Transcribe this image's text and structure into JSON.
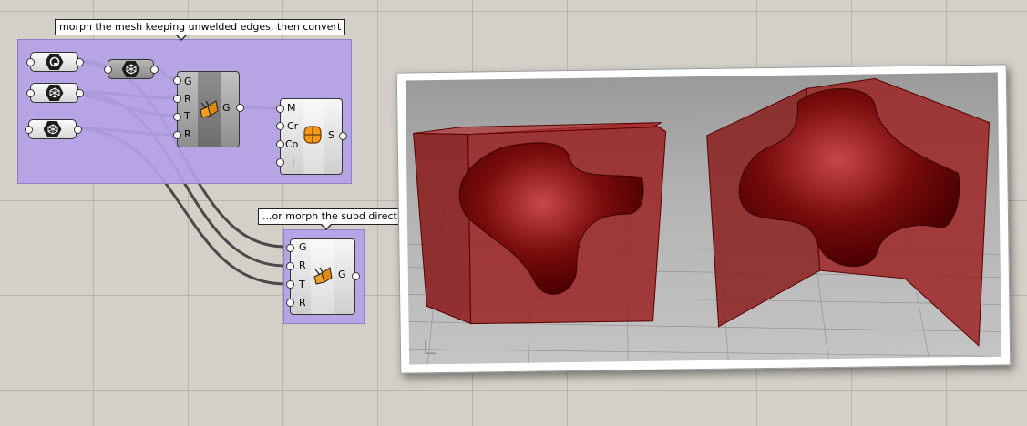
{
  "groups": {
    "mesh_group_label": "morph the mesh keeping unwelded edges, then convert",
    "subd_group_label": "...or morph the subd directly"
  },
  "param_icons": [
    "subd-param-icon",
    "mesh-param-icon",
    "mesh-param-icon",
    "mesh-param-icon"
  ],
  "morph_component_1": {
    "inputs": [
      "G",
      "R",
      "T",
      "R"
    ],
    "output": "G",
    "icon": "box-morph-icon"
  },
  "subd_from_mesh": {
    "inputs": [
      "M",
      "Cr",
      "Co",
      "I"
    ],
    "output": "S",
    "icon": "subd-from-mesh-icon"
  },
  "morph_component_2": {
    "inputs": [
      "G",
      "R",
      "T",
      "R"
    ],
    "output": "G",
    "icon": "box-morph-icon"
  },
  "colors": {
    "canvas": "#d4d0c8",
    "group_fill": "#b3a0e6",
    "wire": "#4a4a4a",
    "model_red": "#8a1010",
    "viewport_bg": "#b0b0b0"
  }
}
